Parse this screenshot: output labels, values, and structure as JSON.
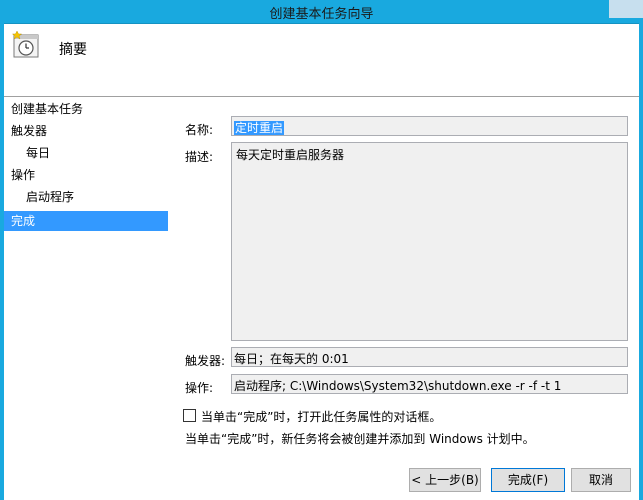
{
  "window": {
    "title": "创建基本任务向导"
  },
  "header": {
    "title": "摘要",
    "icon": "task-clock-icon"
  },
  "nav": {
    "items": [
      {
        "label": "创建基本任务",
        "sub": false,
        "selected": false
      },
      {
        "label": "触发器",
        "sub": false,
        "selected": false
      },
      {
        "label": "每日",
        "sub": true,
        "selected": false
      },
      {
        "label": "操作",
        "sub": false,
        "selected": false
      },
      {
        "label": "启动程序",
        "sub": true,
        "selected": false
      },
      {
        "label": "完成",
        "sub": false,
        "selected": true
      }
    ]
  },
  "form": {
    "name_label": "名称:",
    "name_value": "定时重启",
    "desc_label": "描述:",
    "desc_value": "每天定时重启服务器",
    "trigger_label": "触发器:",
    "trigger_value": "每日；在每天的 0:01",
    "action_label": "操作:",
    "action_value": "启动程序; C:\\Windows\\System32\\shutdown.exe -r -f -t 1",
    "checkbox_label": "当单击“完成”时，打开此任务属性的对话框。",
    "checkbox_checked": false,
    "info_text": "当单击“完成”时，新任务将会被创建并添加到 Windows 计划中。"
  },
  "buttons": {
    "back": "< 上一步(B)",
    "finish": "完成(F)",
    "cancel": "取消"
  },
  "colors": {
    "titlebar": "#19a9df",
    "selection": "#3399ff"
  }
}
